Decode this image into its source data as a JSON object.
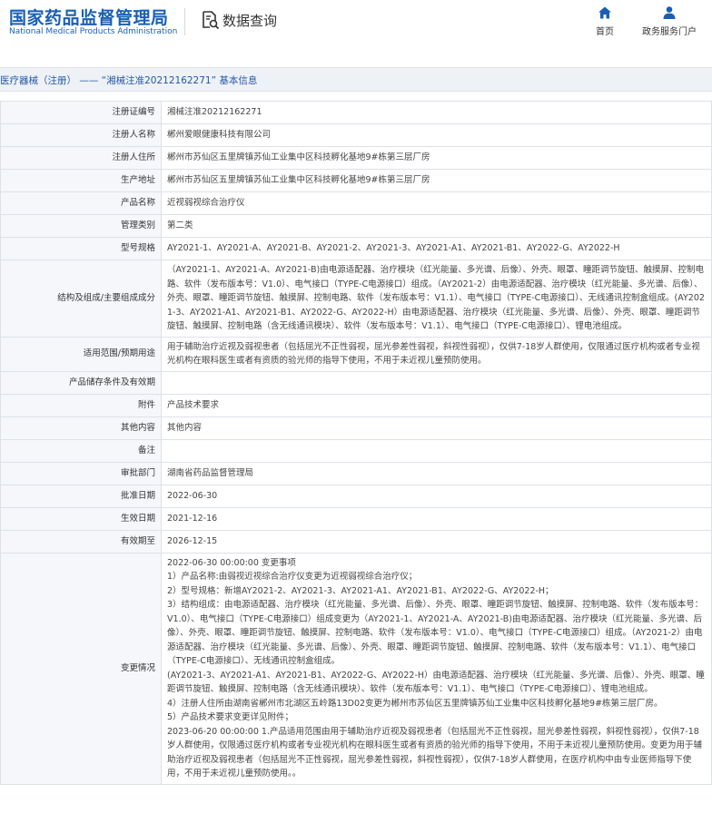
{
  "header": {
    "logo_cn": "国家药品监督管理局",
    "logo_en": "National Medical Products Administration",
    "query_label": "数据查询",
    "nav": [
      {
        "label": "首页",
        "icon": "home-icon"
      },
      {
        "label": "政务服务门户",
        "icon": "user-icon"
      }
    ]
  },
  "colors": {
    "brand": "#1a5fb4",
    "label_bg": "#f5f7fa",
    "border": "#dde2e8",
    "title_bar_bg": "#eef1f5"
  },
  "page_title": "医疗器械（注册） —— “湘械注准20212162271” 基本信息",
  "fields": [
    {
      "label": "注册证编号",
      "value": "湘械注准20212162271"
    },
    {
      "label": "注册人名称",
      "value": "郴州爱眼健康科技有限公司"
    },
    {
      "label": "注册人住所",
      "value": "郴州市苏仙区五里牌镇苏仙工业集中区科技孵化基地9#栋第三层厂房"
    },
    {
      "label": "生产地址",
      "value": "郴州市苏仙区五里牌镇苏仙工业集中区科技孵化基地9#栋第三层厂房"
    },
    {
      "label": "产品名称",
      "value": "近视弱视综合治疗仪"
    },
    {
      "label": "管理类别",
      "value": "第二类"
    },
    {
      "label": "型号规格",
      "value": "AY2021-1、AY2021-A、AY2021-B、AY2021-2、AY2021-3、AY2021-A1、AY2021-B1、AY2022-G、AY2022-H"
    },
    {
      "label": "结构及组成/主要组成成分",
      "value": "（AY2021-1、AY2021-A、AY2021-B)由电源适配器、治疗模块（红光能量、多光谱、后像）、外壳、眼罩、瞳距调节旋钮、触摸屏、控制电路、软件（发布版本号：V1.0）、电气接口（TYPE-C电源接口）组成。（AY2021-2）由电源适配器、治疗模块（红光能量、多光谱、后像）、外壳、眼罩、瞳距调节旋钮、触摸屏、控制电路、软件（发布版本号：V1.1）、电气接口（TYPE-C电源接口）、无线通讯控制盒组成。(AY2021-3、AY2021-A1、AY2021-B1、AY2022-G、AY2022-H）由电源适配器、治疗模块（红光能量、多光谱、后像）、外壳、眼罩、瞳距调节旋钮、触摸屏、控制电路（含无线通讯模块）、软件（发布版本号：V1.1）、电气接口（TYPE-C电源接口）、锂电池组成。"
    },
    {
      "label": "适用范围/预期用途",
      "value": "用于辅助治疗近视及弱视患者（包括屈光不正性弱视，屈光参差性弱视，斜视性弱视），仅供7-18岁人群使用，仅限通过医疗机构或者专业视光机构在眼科医生或者有资质的验光师的指导下使用，不用于未近视儿童预防使用。"
    },
    {
      "label": "产品储存条件及有效期",
      "value": ""
    },
    {
      "label": "附件",
      "value": "产品技术要求"
    },
    {
      "label": "其他内容",
      "value": "其他内容"
    },
    {
      "label": "备注",
      "value": ""
    },
    {
      "label": "审批部门",
      "value": "湖南省药品监督管理局"
    },
    {
      "label": "批准日期",
      "value": "2022-06-30"
    },
    {
      "label": "生效日期",
      "value": "2021-12-16"
    },
    {
      "label": "有效期至",
      "value": "2026-12-15"
    }
  ],
  "change": {
    "label": "变更情况",
    "lines": [
      "2022-06-30 00:00:00 变更事项",
      "1）产品名称:由弱视近视综合治疗仪变更为近视弱视综合治疗仪；",
      "2）型号规格：新增AY2021-2、AY2021-3、AY2021-A1、AY2021-B1、AY2022-G、AY2022-H；",
      "3）结构组成：由电源适配器、治疗模块（红光能量、多光谱、后像）、外壳、眼罩、瞳距调节旋钮、触摸屏、控制电路、软件（发布版本号：V1.0）、电气接口（TYPE-C电源接口）组成变更为（AY2021-1、AY2021-A、AY2021-B)由电源适配器、治疗模块（红光能量、多光谱、后像）、外壳、眼罩、瞳距调节旋钮、触摸屏、控制电路、软件（发布版本号：V1.0）、电气接口（TYPE-C电源接口）组成。（AY2021-2）由电源适配器、治疗模块（红光能量、多光谱、后像）、外壳、眼罩、瞳距调节旋钮、触摸屏、控制电路、软件（发布版本号：V1.1）、电气接口（TYPE-C电源接口）、无线通讯控制盒组成。",
      "(AY2021-3、AY2021-A1、AY2021-B1、AY2022-G、AY2022-H）由电源适配器、治疗模块（红光能量、多光谱、后像）、外壳、眼罩、瞳距调节旋钮、触摸屏、控制电路（含无线通讯模块）、软件（发布版本号：V1.1）、电气接口（TYPE-C电源接口）、锂电池组成。",
      "4）注册人住所由湖南省郴州市北湖区五岭路13D02变更为郴州市苏仙区五里牌镇苏仙工业集中区科技孵化基地9#栋第三层厂房。",
      "5）产品技术要求变更详见附件；",
      "2023-06-20 00:00:00 1.产品适用范围由用于辅助治疗近视及弱视患者（包括屈光不正性弱视，屈光参差性弱视，斜视性弱视），仅供7-18岁人群使用，仅限通过医疗机构或者专业视光机构在眼科医生或者有资质的验光师的指导下使用，不用于未近视儿童预防使用。变更为用于辅助治疗近视及弱视患者（包括屈光不正性弱视，屈光参差性弱视，斜视性弱视），仅供7-18岁人群使用，在医疗机构中由专业医师指导下使用，不用于未近视儿童预防使用。。"
    ]
  }
}
